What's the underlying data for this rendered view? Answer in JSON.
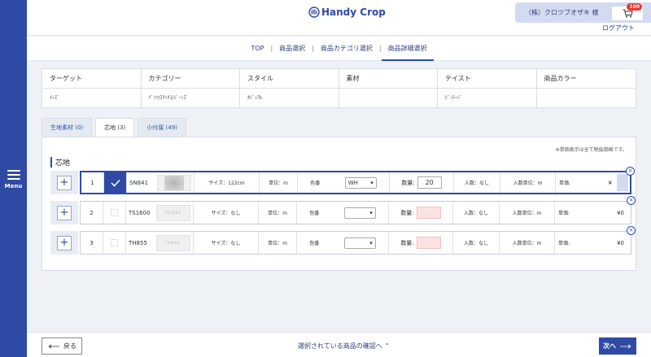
{
  "sidebar": {
    "menu_label": "Menu"
  },
  "header": {
    "brand": "Handy Crop",
    "user_name": "（株）クロツブオザキ 様",
    "cart_count": "100",
    "logout": "ログアウト"
  },
  "steps": [
    "TOP",
    "商品選択",
    "商品カテゴリ選択",
    "商品詳細選択"
  ],
  "step_separator": "|",
  "attributes": [
    {
      "label": "ターゲット",
      "value": "ﾒﾝｽﾞ"
    },
    {
      "label": "カテゴリー",
      "value": "ﾊﾟﾝﾂ/ｽﾗｯｸｽ/ｼﾞｰﾝｽﾞ"
    },
    {
      "label": "スタイル",
      "value": "ｶｼﾞｭｱﾙ"
    },
    {
      "label": "素材",
      "value": ""
    },
    {
      "label": "テイスト",
      "value": "ﾋﾞﾝﾃｰｼﾞ"
    },
    {
      "label": "商品カラー",
      "value": ""
    }
  ],
  "tabs": [
    "生地素材 (0)",
    "芯地 (3)",
    "小付属 (49)"
  ],
  "panel": {
    "note": "※単価表示は全て税抜価格です。",
    "section_title": "芯地"
  },
  "row_labels": {
    "unit": "単位：m",
    "color": "色番",
    "qty": "数量:",
    "pack": "入数：なし",
    "pack_unit": "入数単位：m",
    "price": "単価:"
  },
  "items": [
    {
      "index": "1",
      "code": "SN841",
      "size": "サイズ：122cm",
      "color_value": "WH",
      "quantity": "20",
      "price": "¥",
      "selected": true
    },
    {
      "index": "2",
      "code": "TS1600",
      "size": "サイズ：なし",
      "color_value": "",
      "quantity": "",
      "price": "¥0",
      "selected": false
    },
    {
      "index": "3",
      "code": "TH855",
      "size": "サイズ：なし",
      "color_value": "",
      "quantity": "",
      "price": "¥0",
      "selected": false
    }
  ],
  "footer": {
    "back": "戻る",
    "confirm": "選択されている商品の確認へ",
    "next": "次へ"
  },
  "colors": {
    "brand": "#2f4aa4",
    "badge": "#e53935",
    "empty_qty": "#fde2e2"
  },
  "icons": [
    "menu-icon",
    "cart-icon",
    "check-icon",
    "plus-icon",
    "close-icon",
    "chevron-down-icon",
    "arrow-left-icon",
    "arrow-right-icon"
  ]
}
